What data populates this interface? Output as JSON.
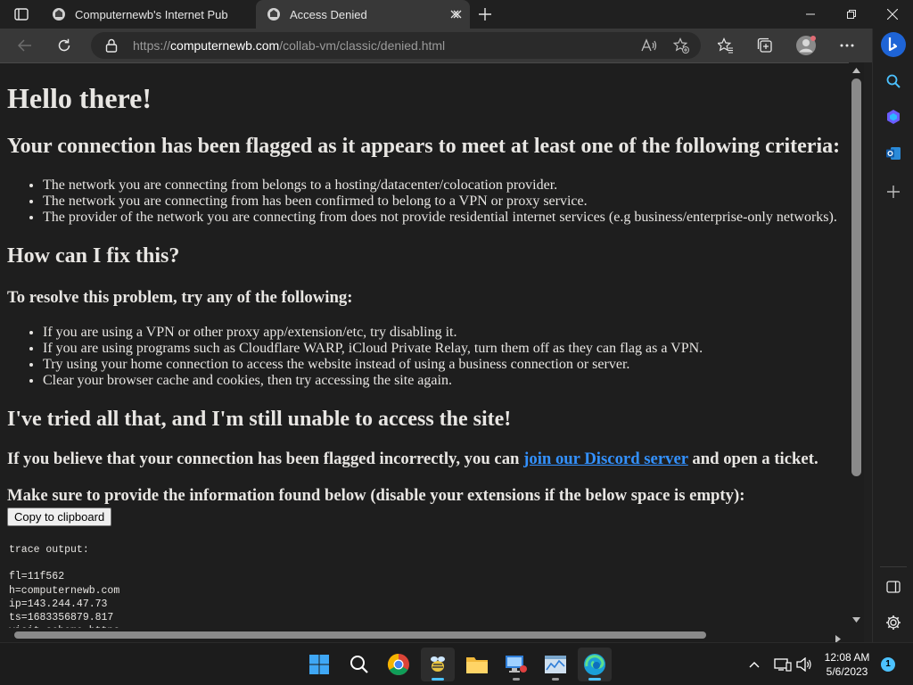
{
  "browser": {
    "tabs": [
      {
        "title": "Computernewb's Internet Pub Hu",
        "active": false
      },
      {
        "title": "Access Denied",
        "active": true
      }
    ],
    "url_prefix": "https://",
    "url_host": "computernewb.com",
    "url_path": "/collab-vm/classic/denied.html"
  },
  "page": {
    "h1": "Hello there!",
    "h2_criteria": "Your connection has been flagged as it appears to meet at least one of the following criteria:",
    "criteria": [
      "The network you are connecting from belongs to a hosting/datacenter/colocation provider.",
      "The network you are connecting from has been confirmed to belong to a VPN or proxy service.",
      "The provider of the network you are connecting from does not provide residential internet services (e.g business/enterprise-only networks)."
    ],
    "h2_fix": "How can I fix this?",
    "h3_resolve": "To resolve this problem, try any of the following:",
    "fixes": [
      "If you are using a VPN or other proxy app/extension/etc, try disabling it.",
      "If you are using programs such as Cloudflare WARP, iCloud Private Relay, turn them off as they can flag as a VPN.",
      "Try using your home connection to access the website instead of using a business connection or server.",
      "Clear your browser cache and cookies, then try accessing the site again."
    ],
    "h2_tried": "I've tried all that, and I'm still unable to access the site!",
    "h3_believe_pre": "If you believe that your connection has been flagged incorrectly, you can",
    "h3_believe_link": "join our Discord server",
    "h3_believe_post": "and open a ticket.",
    "h3_info": "Make sure to provide the information found below (disable your extensions if the below space is empty):",
    "copy_button": "Copy to clipboard",
    "trace": "trace output:\n\nfl=11f562\nh=computernewb.com\nip=143.244.47.73\nts=1683356879.817\nvisit_scheme=https"
  },
  "taskbar": {
    "time": "12:08 AM",
    "date": "5/6/2023",
    "notifications": "1"
  }
}
